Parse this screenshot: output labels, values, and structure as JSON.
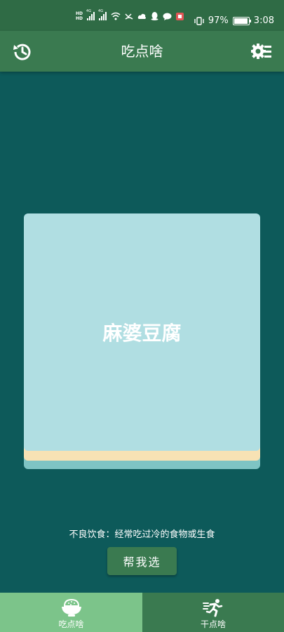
{
  "status_bar": {
    "hd_top": "HD",
    "hd_bottom": "HD",
    "network_1": "4G",
    "network_2": "4G",
    "battery": "97%",
    "time": "3:08"
  },
  "app_bar": {
    "title": "吃点啥",
    "history_icon": "history-icon",
    "settings_icon": "settings-list-icon"
  },
  "card": {
    "dish": "麻婆豆腐"
  },
  "tip": "不良饮食：经常吃过冷的食物或生食",
  "choose_button": "帮我选",
  "bottom_nav": {
    "items": [
      {
        "label": "吃点啥",
        "icon": "rice-bowl-icon",
        "active": true
      },
      {
        "label": "干点啥",
        "icon": "running-icon",
        "active": false
      }
    ]
  },
  "colors": {
    "background": "#0d5a5a",
    "primary": "#3a7a50",
    "active_tab": "#7cc48a",
    "card": "#b0dee2"
  }
}
